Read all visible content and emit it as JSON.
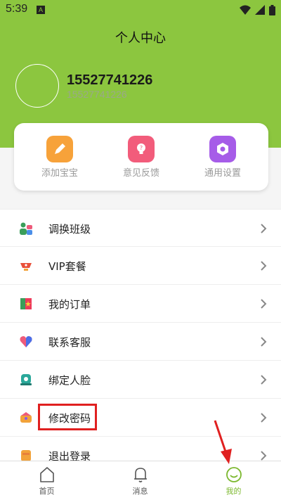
{
  "status": {
    "time": "5:39",
    "notification": "A"
  },
  "header": {
    "title": "个人中心"
  },
  "user": {
    "name": "15527741226",
    "id": "15527741226"
  },
  "quick_actions": [
    {
      "label": "添加宝宝",
      "icon": "pencil-icon",
      "color": "#f7a23a"
    },
    {
      "label": "意见反馈",
      "icon": "lightbulb-icon",
      "color": "#f25c7b"
    },
    {
      "label": "通用设置",
      "icon": "settings-icon",
      "color": "#a65ce8"
    }
  ],
  "menu": [
    {
      "label": "调换班级",
      "icon": "people-icon"
    },
    {
      "label": "VIP套餐",
      "icon": "vip-crown-icon"
    },
    {
      "label": "我的订单",
      "icon": "order-book-icon"
    },
    {
      "label": "联系客服",
      "icon": "heart-chat-icon"
    },
    {
      "label": "绑定人脸",
      "icon": "face-bind-icon"
    },
    {
      "label": "修改密码",
      "icon": "password-icon"
    },
    {
      "label": "退出登录",
      "icon": "logout-icon"
    }
  ],
  "tabs": [
    {
      "label": "首页",
      "icon": "home-icon",
      "active": false
    },
    {
      "label": "消息",
      "icon": "bell-icon",
      "active": false
    },
    {
      "label": "我的",
      "icon": "smile-icon",
      "active": true
    }
  ],
  "colors": {
    "brand_green": "#8cc63f",
    "active_tab": "#7cb82f",
    "highlight_red": "#e02020"
  }
}
